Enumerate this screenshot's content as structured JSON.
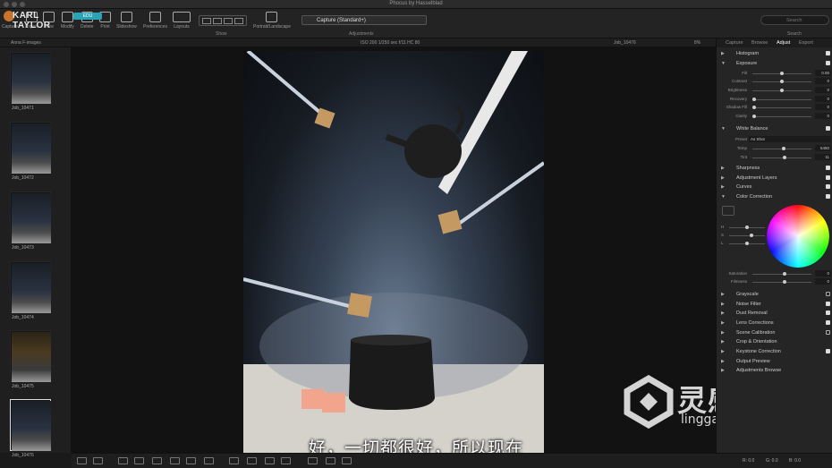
{
  "window": {
    "title": "Phocus by Hasselblad"
  },
  "logo": {
    "name": "KARL TAYLOR",
    "badge": "EDU"
  },
  "toolbar": {
    "items": [
      "Capture",
      "Export",
      "View",
      "Modify",
      "Delete",
      "Print",
      "Slideshow",
      "Preferences",
      "Layouts",
      "Show",
      "Portrait/Landscape"
    ],
    "preset_value": "Capture (Standard+)",
    "adjustments_label": "Adjustments",
    "search_placeholder": "Search",
    "search_label": "Search"
  },
  "infobar": {
    "folder": "Anna F-images",
    "exif": "ISO 200   1/250 sec   f/11   HC 80",
    "filename": "Job_10476",
    "zoom": "8%"
  },
  "filmstrip": {
    "thumbs": [
      "Job_10471",
      "Job_10472",
      "Job_10473",
      "Job_10474",
      "Job_10475",
      "Job_10476"
    ],
    "selected": "Job_10476"
  },
  "subtitle": "好，一切都很好，所以现在",
  "panel": {
    "tabs": [
      "Capture",
      "Browse",
      "Adjust",
      "Export"
    ],
    "active_tab": "Adjust",
    "sections": [
      "Histogram",
      "Exposure",
      "White Balance",
      "Sharpness",
      "Adjustment Layers",
      "Curves",
      "Color Correction",
      "Grayscale",
      "Noise Filter",
      "Dust Removal",
      "Lens Corrections",
      "Scene Calibration",
      "Crop & Orientation",
      "Keystone Correction",
      "Output Preview",
      "Adjustments Browse"
    ],
    "exposure": {
      "fill_label": "Fill",
      "fill_value": "0.00",
      "contrast_label": "Contrast",
      "contrast_value": "0",
      "brightness_label": "Brightness",
      "brightness_value": "0",
      "recovery_label": "Recovery",
      "recovery_value": "0",
      "shadow_label": "Shadow Fill",
      "shadow_value": "0",
      "clarity_label": "Clarity",
      "clarity_value": "0"
    },
    "white_balance": {
      "preset_label": "Preset",
      "preset_value": "As Shot",
      "temp_label": "Temp",
      "temp_value": "5450",
      "tint_label": "Tint",
      "tint_value": "11"
    },
    "color_correction": {
      "h_label": "H",
      "s_label": "S",
      "l_label": "L",
      "saturation_label": "Saturation",
      "saturation_value": "0",
      "filmness_label": "Filmness",
      "filmness_value": "0"
    }
  },
  "statusbar": {
    "r": "R: 0.0",
    "g": "G: 0.0",
    "b": "B: 0.0"
  },
  "watermark": {
    "text": "灵感中国",
    "url": "lingganchina.com"
  },
  "colors": {
    "accent": "#2ba3b5",
    "logo_badge": "#c8742c",
    "background": "#1a1a1a"
  }
}
